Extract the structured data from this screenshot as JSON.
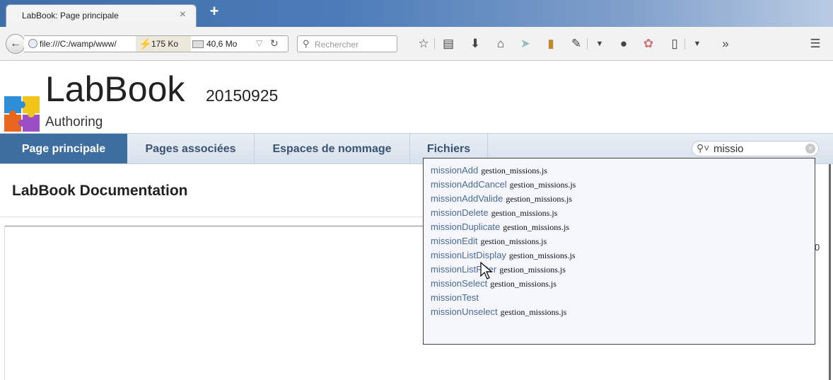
{
  "browser": {
    "tab_title": "LabBook: Page principale",
    "tab_close": "×",
    "new_tab": "+",
    "url": "file:///C:/wamp/www/",
    "stat_size": "175 Ko",
    "stat_memory": "40,6 Mo",
    "search_placeholder": "Rechercher",
    "toolbar_icons": [
      "star-icon",
      "clipboard-icon",
      "download-icon",
      "home-icon",
      "send-icon",
      "bookmark-icon",
      "pen-icon",
      "dropdown-icon",
      "chat-icon",
      "addon-icon",
      "phone-icon",
      "dropdown-icon",
      "overflow-icon",
      "menu-icon"
    ]
  },
  "header": {
    "title": "LabBook",
    "version": "20150925",
    "subtitle": "Authoring"
  },
  "menu": {
    "items": [
      {
        "label": "Page principale",
        "active": true
      },
      {
        "label": "Pages associées",
        "active": false
      },
      {
        "label": "Espaces de nommage",
        "active": false
      },
      {
        "label": "Fichiers",
        "active": false
      }
    ],
    "search_value": "missio"
  },
  "main": {
    "heading": "LabBook Documentation",
    "fragment": "0"
  },
  "suggestions": [
    {
      "name": "missionAdd",
      "file": "gestion_missions.js"
    },
    {
      "name": "missionAddCancel",
      "file": "gestion_missions.js"
    },
    {
      "name": "missionAddValide",
      "file": "gestion_missions.js"
    },
    {
      "name": "missionDelete",
      "file": "gestion_missions.js"
    },
    {
      "name": "missionDuplicate",
      "file": "gestion_missions.js"
    },
    {
      "name": "missionEdit",
      "file": "gestion_missions.js"
    },
    {
      "name": "missionListDisplay",
      "file": "gestion_missions.js"
    },
    {
      "name": "missionListFilter",
      "file": "gestion_missions.js"
    },
    {
      "name": "missionSelect",
      "file": "gestion_missions.js"
    },
    {
      "name": "missionTest",
      "file": ""
    },
    {
      "name": "missionUnselect",
      "file": "gestion_missions.js"
    }
  ]
}
